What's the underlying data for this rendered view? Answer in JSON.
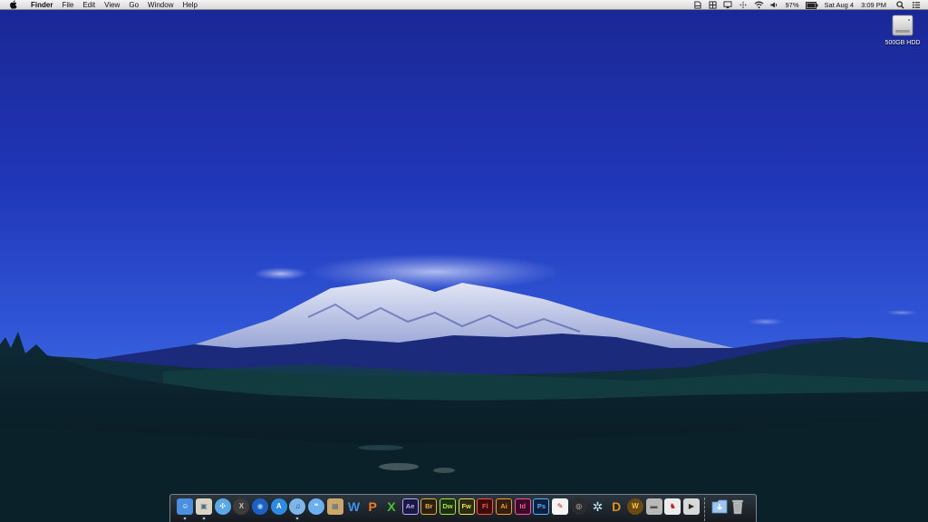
{
  "menubar": {
    "apple_icon": "apple-icon",
    "app_name": "Finder",
    "menus": [
      "File",
      "Edit",
      "View",
      "Go",
      "Window",
      "Help"
    ],
    "status": {
      "icons": [
        "document-icon",
        "grid-icon",
        "airplay-icon",
        "bluetooth-icon",
        "wifi-icon",
        "volume-icon"
      ],
      "battery_percent": "97%",
      "battery_icon": "battery-icon",
      "date": "Sat Aug 4",
      "time": "3:09 PM",
      "search_icon": "spotlight-search-icon",
      "list_icon": "notification-center-icon"
    }
  },
  "desktop": {
    "drive": {
      "label": "500GB HDD",
      "icon": "hard-drive-icon"
    }
  },
  "dock": {
    "apps": [
      {
        "name": "Finder",
        "icon": "finder-icon",
        "running": true,
        "glyph": "☺",
        "bg": "#4a8fe0",
        "fg": "#ffffff"
      },
      {
        "name": "Preview",
        "icon": "preview-icon",
        "running": true,
        "glyph": "▣",
        "bg": "#d9d4c4",
        "fg": "#556b8a"
      },
      {
        "name": "Safari",
        "icon": "safari-icon",
        "running": false,
        "glyph": "✣",
        "bg": "#5aa8e8",
        "fg": "#ffffff",
        "round": true
      },
      {
        "name": "Mac OS X",
        "icon": "mac-os-x-icon",
        "running": false,
        "glyph": "X",
        "bg": "#3c3c3c",
        "fg": "#c8c8c8",
        "round": true
      },
      {
        "name": "Network",
        "icon": "globe-icon",
        "running": false,
        "glyph": "◉",
        "bg": "#1e5fbf",
        "fg": "#9fd0ff",
        "round": true
      },
      {
        "name": "App Store",
        "icon": "app-store-icon",
        "running": false,
        "glyph": "A",
        "bg": "#2e8be0",
        "fg": "#ffffff",
        "round": true
      },
      {
        "name": "iTunes",
        "icon": "itunes-icon",
        "running": true,
        "glyph": "♫",
        "bg": "#7fb6ea",
        "fg": "#0d3f8a",
        "round": true
      },
      {
        "name": "Messages",
        "icon": "messages-icon",
        "running": false,
        "glyph": "❝",
        "bg": "#6cb0f0",
        "fg": "#ffffff",
        "round": true
      },
      {
        "name": "Installer",
        "icon": "package-icon",
        "running": false,
        "glyph": "▦",
        "bg": "#c9a86a",
        "fg": "#5a6f8c"
      },
      {
        "name": "Word",
        "icon": "word-icon",
        "running": false,
        "glyph": "W",
        "bg": "transparent",
        "fg": "#3f8fe6"
      },
      {
        "name": "PowerPoint",
        "icon": "powerpoint-icon",
        "running": false,
        "glyph": "P",
        "bg": "transparent",
        "fg": "#f07a28"
      },
      {
        "name": "Excel",
        "icon": "excel-icon",
        "running": false,
        "glyph": "X",
        "bg": "transparent",
        "fg": "#4cbf3a"
      },
      {
        "name": "After Effects",
        "icon": "after-effects-icon",
        "running": false,
        "glyph": "Ae",
        "bg": "#1a1a40",
        "fg": "#b8a6ff",
        "adobe": true
      },
      {
        "name": "Bridge",
        "icon": "bridge-icon",
        "running": false,
        "glyph": "Br",
        "bg": "#2a1f10",
        "fg": "#e0b040",
        "adobe": true
      },
      {
        "name": "Dreamweaver",
        "icon": "dreamweaver-icon",
        "running": false,
        "glyph": "Dw",
        "bg": "#1c3010",
        "fg": "#a8e040",
        "adobe": true
      },
      {
        "name": "Fireworks",
        "icon": "fireworks-icon",
        "running": false,
        "glyph": "Fw",
        "bg": "#2c2c10",
        "fg": "#e8e050",
        "adobe": true
      },
      {
        "name": "Flash",
        "icon": "flash-icon",
        "running": false,
        "glyph": "Fl",
        "bg": "#3c0c0c",
        "fg": "#ff5040",
        "adobe": true
      },
      {
        "name": "Illustrator",
        "icon": "illustrator-icon",
        "running": false,
        "glyph": "Ai",
        "bg": "#332010",
        "fg": "#ff9a2a",
        "adobe": true
      },
      {
        "name": "InDesign",
        "icon": "indesign-icon",
        "running": false,
        "glyph": "Id",
        "bg": "#3a0c28",
        "fg": "#ff4fa6",
        "adobe": true
      },
      {
        "name": "Photoshop",
        "icon": "photoshop-icon",
        "running": false,
        "glyph": "Ps",
        "bg": "#0c2040",
        "fg": "#5ab0ff",
        "adobe": true
      },
      {
        "name": "Acrobat",
        "icon": "acrobat-icon",
        "running": false,
        "glyph": "✎",
        "bg": "#f4f4f4",
        "fg": "#d01010"
      },
      {
        "name": "Aperture",
        "icon": "aperture-icon",
        "running": false,
        "glyph": "◎",
        "bg": "#2c2c2c",
        "fg": "#c8c8c8",
        "round": true
      },
      {
        "name": "Utility",
        "icon": "tool-icon",
        "running": false,
        "glyph": "✲",
        "bg": "transparent",
        "fg": "#bfe6ff"
      },
      {
        "name": "Diablo",
        "icon": "diablo-icon",
        "running": false,
        "glyph": "D",
        "bg": "transparent",
        "fg": "#e09020"
      },
      {
        "name": "World of Warcraft",
        "icon": "warcraft-icon",
        "running": false,
        "glyph": "W",
        "bg": "#6a4a10",
        "fg": "#f0c850",
        "round": true
      },
      {
        "name": "Scanner",
        "icon": "scanner-icon",
        "running": false,
        "glyph": "▬",
        "bg": "#b8b8b8",
        "fg": "#505050"
      },
      {
        "name": "Chess",
        "icon": "chess-icon",
        "running": false,
        "glyph": "♞",
        "bg": "#ececec",
        "fg": "#c01818"
      },
      {
        "name": "FaceTime",
        "icon": "video-camera-icon",
        "running": false,
        "glyph": "▶",
        "bg": "#d8d8d8",
        "fg": "#2a2a2a"
      },
      {
        "name": "Downloads",
        "icon": "downloads-folder-icon",
        "running": false,
        "glyph": "",
        "bg": "#8fb8e6",
        "fg": "#ffffff"
      },
      {
        "name": "Trash",
        "icon": "trash-icon",
        "running": false,
        "glyph": "",
        "bg": "#c8c8c8",
        "fg": "#8a8a8a"
      }
    ]
  }
}
